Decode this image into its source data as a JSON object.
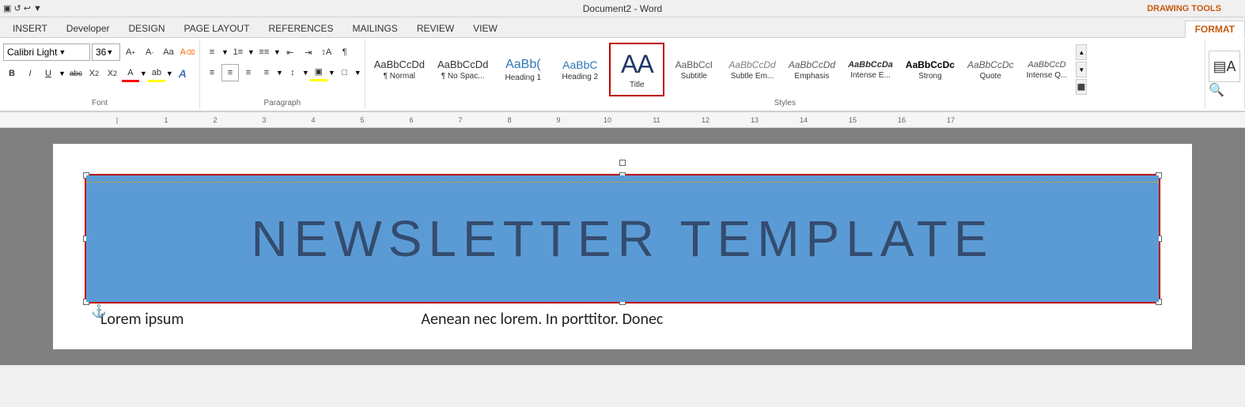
{
  "titlebar": {
    "title": "Document2 - Word",
    "quick_access": "▣ ↩",
    "drawing_tools_label": "DRAWING TOOLS"
  },
  "tabs": [
    {
      "label": "INSERT",
      "active": false
    },
    {
      "label": "Developer",
      "active": false
    },
    {
      "label": "DESIGN",
      "active": false
    },
    {
      "label": "PAGE LAYOUT",
      "active": false
    },
    {
      "label": "REFERENCES",
      "active": false
    },
    {
      "label": "MAILINGS",
      "active": false
    },
    {
      "label": "REVIEW",
      "active": false
    },
    {
      "label": "VIEW",
      "active": false
    },
    {
      "label": "FORMAT",
      "active": true,
      "drawing_tools": true
    }
  ],
  "font": {
    "name": "Calibri Light",
    "size": "36",
    "label": "Font"
  },
  "paragraph": {
    "label": "Paragraph"
  },
  "styles": {
    "label": "Styles",
    "items": [
      {
        "id": "normal",
        "preview": "AaBbCcDd",
        "name": "¶ Normal",
        "class": "preview-normal"
      },
      {
        "id": "no-space",
        "preview": "AaBbCcDd",
        "name": "¶ No Spac...",
        "class": "preview-no-space"
      },
      {
        "id": "heading1",
        "preview": "AaBb(",
        "name": "Heading 1",
        "class": "preview-heading1"
      },
      {
        "id": "heading2",
        "preview": "AaBbC",
        "name": "Heading 2",
        "class": "preview-heading2"
      },
      {
        "id": "title",
        "preview": "AA",
        "name": "Title",
        "class": "preview-title",
        "selected": true
      },
      {
        "id": "subtitle",
        "preview": "AaBbCcI",
        "name": "Subtitle",
        "class": "preview-subtitle"
      },
      {
        "id": "subtle-em",
        "preview": "AaBbCcDd",
        "name": "Subtle Em...",
        "class": "preview-subtle-em"
      },
      {
        "id": "emphasis",
        "preview": "AaBbCcDd",
        "name": "Emphasis",
        "class": "preview-emphasis"
      },
      {
        "id": "intense-e",
        "preview": "AaBbCcDa",
        "name": "Intense E...",
        "class": "preview-intense-e"
      },
      {
        "id": "strong",
        "preview": "AaBbCcDc",
        "name": "Strong",
        "class": "preview-strong"
      },
      {
        "id": "quote",
        "preview": "AaBbCcD",
        "name": "Quote",
        "class": "preview-quote"
      }
    ]
  },
  "ruler": {
    "numbers": [
      "1",
      "2",
      "3",
      "4",
      "5",
      "6",
      "7",
      "8",
      "9",
      "10",
      "11",
      "12",
      "13",
      "14",
      "15",
      "16",
      "17"
    ]
  },
  "document": {
    "textbox": {
      "content": "NEWSLETTER TEMPLATE"
    },
    "bottom_text_left": "Lorem ipsum",
    "bottom_text_right": "Aenean nec lorem. In porttitor. Donec"
  }
}
